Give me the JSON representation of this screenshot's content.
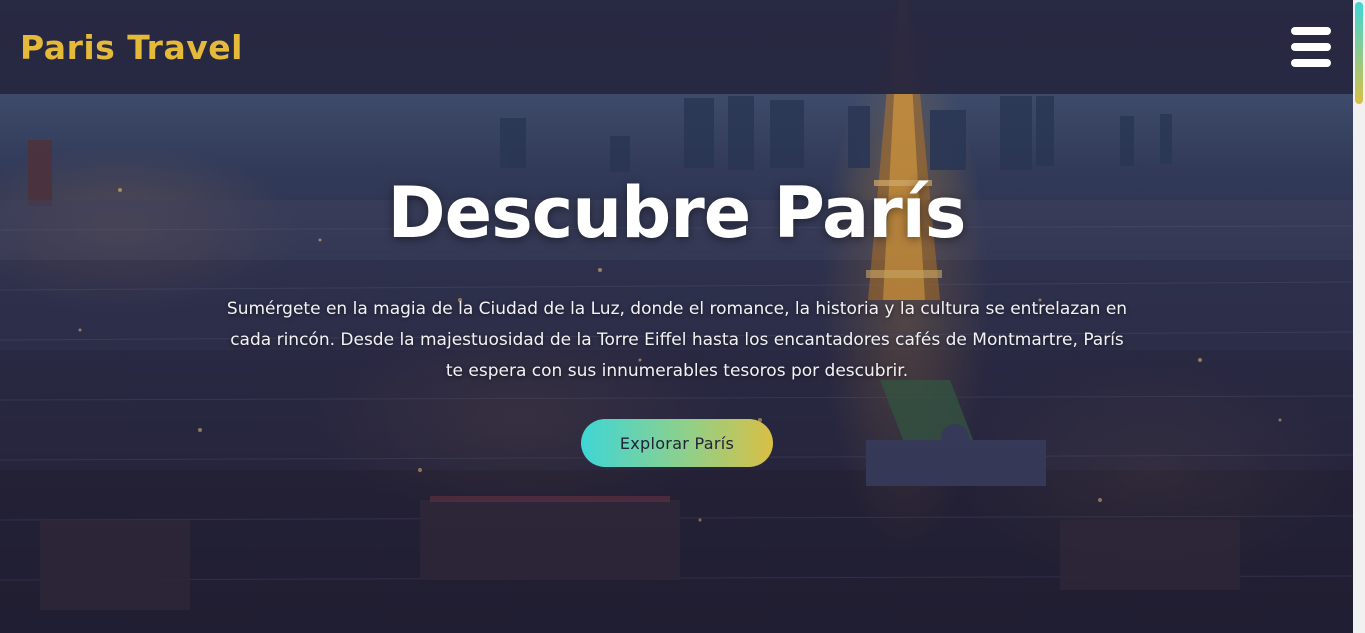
{
  "header": {
    "logo": "Paris Travel",
    "menu_icon": "hamburger-menu-icon"
  },
  "hero": {
    "title": "Descubre París",
    "description": "Sumérgete en la magia de la Ciudad de la Luz, donde el romance, la historia y la cultura se entrelazan en cada rincón. Desde la majestuosidad de la Torre Eiffel hasta los encantadores cafés de Montmartre, París te espera con sus innumerables tesoros por descubrir.",
    "cta_label": "Explorar París",
    "background_image": "paris-night-cityscape-eiffel-tower"
  },
  "colors": {
    "accent_gold": "#e5b93a",
    "header_bg": "#262740",
    "cta_gradient_start": "#3fd6d6",
    "cta_gradient_end": "#d9bf45",
    "text_light": "#ffffff"
  }
}
